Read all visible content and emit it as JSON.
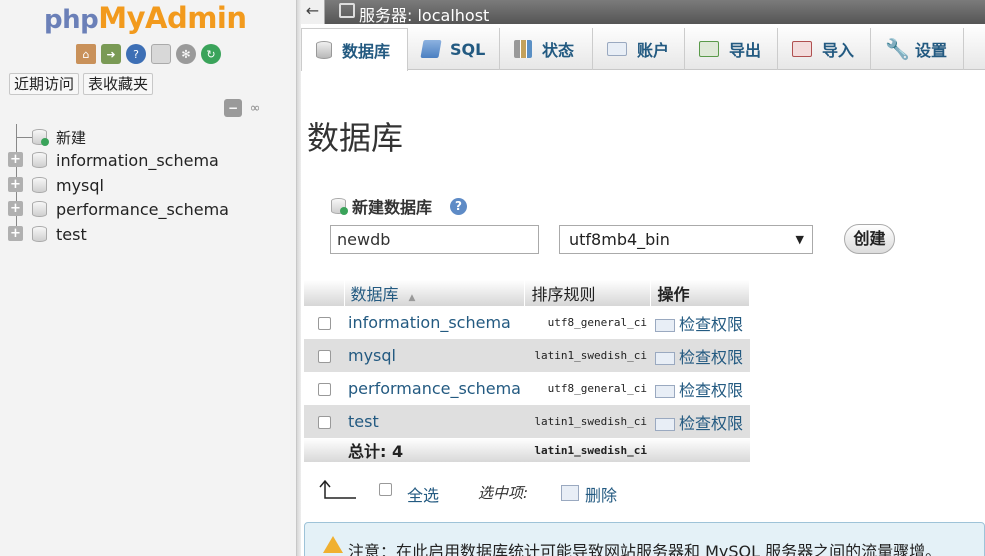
{
  "nav": {
    "logo": {
      "php": "php",
      "my": "My",
      "admin": "Admin"
    },
    "icons": [
      "home-icon",
      "exit-icon",
      "help-icon",
      "docs-icon",
      "settings-icon",
      "reload-icon"
    ],
    "tabs": [
      "近期访问",
      "表收藏夹"
    ],
    "tree": [
      {
        "label": "新建",
        "icon": "new-database-icon"
      },
      {
        "label": "information_schema",
        "icon": "database-icon"
      },
      {
        "label": "mysql",
        "icon": "database-icon"
      },
      {
        "label": "performance_schema",
        "icon": "database-icon"
      },
      {
        "label": "test",
        "icon": "database-icon"
      }
    ]
  },
  "topbar": {
    "server_label": "服务器: localhost"
  },
  "menu": {
    "tabs": [
      {
        "label": "数据库",
        "icon": "database-icon"
      },
      {
        "label": "SQL",
        "icon": "sql-icon"
      },
      {
        "label": "状态",
        "icon": "status-icon"
      },
      {
        "label": "账户",
        "icon": "accounts-icon"
      },
      {
        "label": "导出",
        "icon": "export-icon"
      },
      {
        "label": "导入",
        "icon": "import-icon"
      },
      {
        "label": "设置",
        "icon": "settings-icon"
      }
    ]
  },
  "main": {
    "title": "数据库",
    "create": {
      "heading": "新建数据库",
      "name_value": "newdb",
      "collation_value": "utf8mb4_bin",
      "button": "创建"
    },
    "table": {
      "headers": {
        "database": "数据库",
        "collation": "排序规则",
        "action": "操作"
      },
      "rows": [
        {
          "name": "information_schema",
          "collation": "utf8_general_ci",
          "action": "检查权限"
        },
        {
          "name": "mysql",
          "collation": "latin1_swedish_ci",
          "action": "检查权限"
        },
        {
          "name": "performance_schema",
          "collation": "utf8_general_ci",
          "action": "检查权限"
        },
        {
          "name": "test",
          "collation": "latin1_swedish_ci",
          "action": "检查权限"
        }
      ],
      "total_label": "总计: 4",
      "total_collation": "latin1_swedish_ci"
    },
    "footer": {
      "select_all": "全选",
      "with_selected": "选中项:",
      "delete": "删除"
    },
    "notice": "注意：在此启用数据库统计可能导致网站服务器和 MySQL 服务器之间的流量骤增。"
  },
  "colors": {
    "link": "#235a81",
    "accent": "#f29a1d",
    "logo_php": "#6b80b8"
  }
}
